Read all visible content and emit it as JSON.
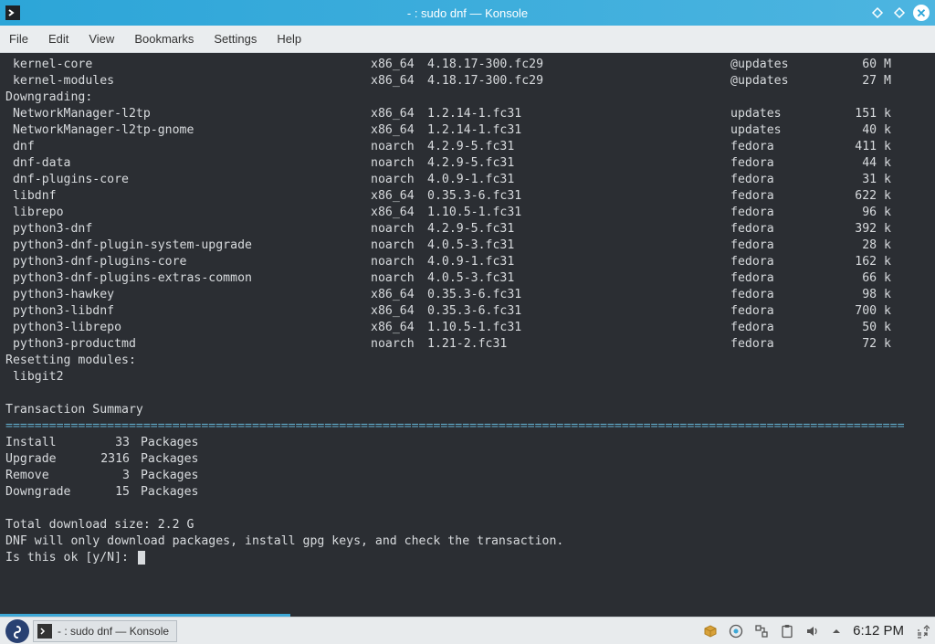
{
  "window": {
    "title": "- : sudo dnf — Konsole"
  },
  "menubar": {
    "file": "File",
    "edit": "Edit",
    "view": "View",
    "bookmarks": "Bookmarks",
    "settings": "Settings",
    "help": "Help"
  },
  "dnf": {
    "upper_packages": [
      {
        "name": " kernel-core",
        "arch": "x86_64",
        "ver": "4.18.17-300.fc29",
        "repo": "@updates",
        "size": "60 M"
      },
      {
        "name": " kernel-modules",
        "arch": "x86_64",
        "ver": "4.18.17-300.fc29",
        "repo": "@updates",
        "size": "27 M"
      }
    ],
    "downgrade_header": "Downgrading:",
    "downgrade_packages": [
      {
        "name": " NetworkManager-l2tp",
        "arch": "x86_64",
        "ver": "1.2.14-1.fc31",
        "repo": "updates",
        "size": "151 k"
      },
      {
        "name": " NetworkManager-l2tp-gnome",
        "arch": "x86_64",
        "ver": "1.2.14-1.fc31",
        "repo": "updates",
        "size": "40 k"
      },
      {
        "name": " dnf",
        "arch": "noarch",
        "ver": "4.2.9-5.fc31",
        "repo": "fedora",
        "size": "411 k"
      },
      {
        "name": " dnf-data",
        "arch": "noarch",
        "ver": "4.2.9-5.fc31",
        "repo": "fedora",
        "size": "44 k"
      },
      {
        "name": " dnf-plugins-core",
        "arch": "noarch",
        "ver": "4.0.9-1.fc31",
        "repo": "fedora",
        "size": "31 k"
      },
      {
        "name": " libdnf",
        "arch": "x86_64",
        "ver": "0.35.3-6.fc31",
        "repo": "fedora",
        "size": "622 k"
      },
      {
        "name": " librepo",
        "arch": "x86_64",
        "ver": "1.10.5-1.fc31",
        "repo": "fedora",
        "size": "96 k"
      },
      {
        "name": " python3-dnf",
        "arch": "noarch",
        "ver": "4.2.9-5.fc31",
        "repo": "fedora",
        "size": "392 k"
      },
      {
        "name": " python3-dnf-plugin-system-upgrade",
        "arch": "noarch",
        "ver": "4.0.5-3.fc31",
        "repo": "fedora",
        "size": "28 k"
      },
      {
        "name": " python3-dnf-plugins-core",
        "arch": "noarch",
        "ver": "4.0.9-1.fc31",
        "repo": "fedora",
        "size": "162 k"
      },
      {
        "name": " python3-dnf-plugins-extras-common",
        "arch": "noarch",
        "ver": "4.0.5-3.fc31",
        "repo": "fedora",
        "size": "66 k"
      },
      {
        "name": " python3-hawkey",
        "arch": "x86_64",
        "ver": "0.35.3-6.fc31",
        "repo": "fedora",
        "size": "98 k"
      },
      {
        "name": " python3-libdnf",
        "arch": "x86_64",
        "ver": "0.35.3-6.fc31",
        "repo": "fedora",
        "size": "700 k"
      },
      {
        "name": " python3-librepo",
        "arch": "x86_64",
        "ver": "1.10.5-1.fc31",
        "repo": "fedora",
        "size": "50 k"
      },
      {
        "name": " python3-productmd",
        "arch": "noarch",
        "ver": "1.21-2.fc31",
        "repo": "fedora",
        "size": "72 k"
      }
    ],
    "reset_header": "Resetting modules:",
    "reset_modules": [
      " libgit2"
    ],
    "blank": " ",
    "summary_header": "Transaction Summary",
    "summary": [
      {
        "action": "Install",
        "count": "33",
        "unit": "Packages"
      },
      {
        "action": "Upgrade",
        "count": "2316",
        "unit": "Packages"
      },
      {
        "action": "Remove",
        "count": "3",
        "unit": "Packages"
      },
      {
        "action": "Downgrade",
        "count": "15",
        "unit": "Packages"
      }
    ],
    "total_line": "Total download size: 2.2 G",
    "note_line": "DNF will only download packages, install gpg keys, and check the transaction.",
    "prompt": "Is this ok [y/N]: "
  },
  "taskbar": {
    "app_title": "- : sudo dnf — Konsole",
    "clock": "6:12 PM",
    "tray_icons": [
      "package-icon",
      "update-icon",
      "network-icon",
      "clipboard-icon",
      "volume-icon",
      "arrow-up-icon",
      "show-desktop-icon"
    ]
  }
}
